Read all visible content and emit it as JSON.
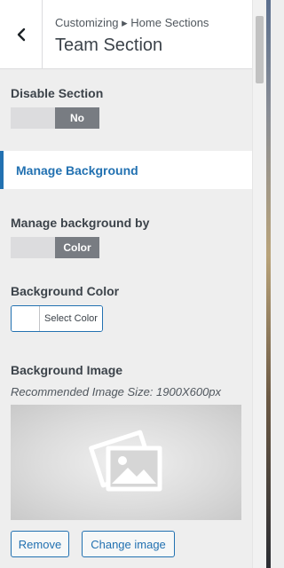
{
  "header": {
    "breadcrumb": "Customizing ▸ Home Sections",
    "title": "Team Section"
  },
  "disable_section": {
    "label": "Disable Section",
    "toggle_value": "No"
  },
  "accordion": {
    "label": "Manage Background"
  },
  "manage_background_by": {
    "label": "Manage background by",
    "toggle_value": "Color"
  },
  "background_color": {
    "label": "Background Color",
    "button_label": "Select Color",
    "swatch_color": "#ffffff"
  },
  "background_image": {
    "label": "Background Image",
    "hint": "Recommended Image Size: 1900X600px",
    "remove_label": "Remove",
    "change_label": "Change image"
  },
  "colors": {
    "accent": "#2271b1",
    "toggle_on": "#787c82",
    "toggle_off": "#dcdcde"
  }
}
